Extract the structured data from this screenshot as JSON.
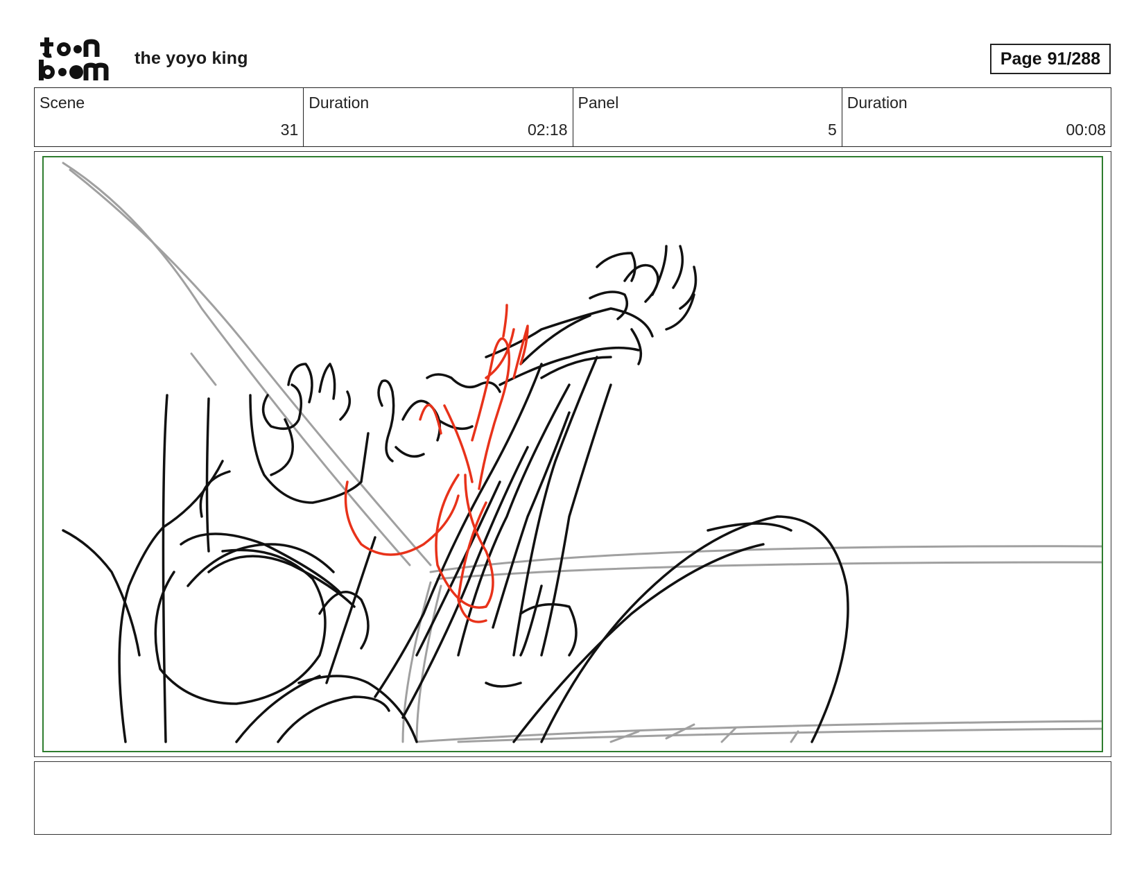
{
  "header": {
    "logo_text": "toon boom",
    "project_title": "the yoyo king",
    "page_label": "Page",
    "page_number": "91/288"
  },
  "info": {
    "scene_label": "Scene",
    "scene_value": "31",
    "scene_duration_label": "Duration",
    "scene_duration_value": "02:18",
    "panel_label": "Panel",
    "panel_value": "5",
    "panel_duration_label": "Duration",
    "panel_duration_value": "00:08"
  },
  "colors": {
    "safe_frame": "#2e7d2e",
    "sketch_main": "#111111",
    "sketch_guide": "#a0a0a0",
    "sketch_accent": "#e8321a"
  },
  "notes": {
    "text": ""
  }
}
